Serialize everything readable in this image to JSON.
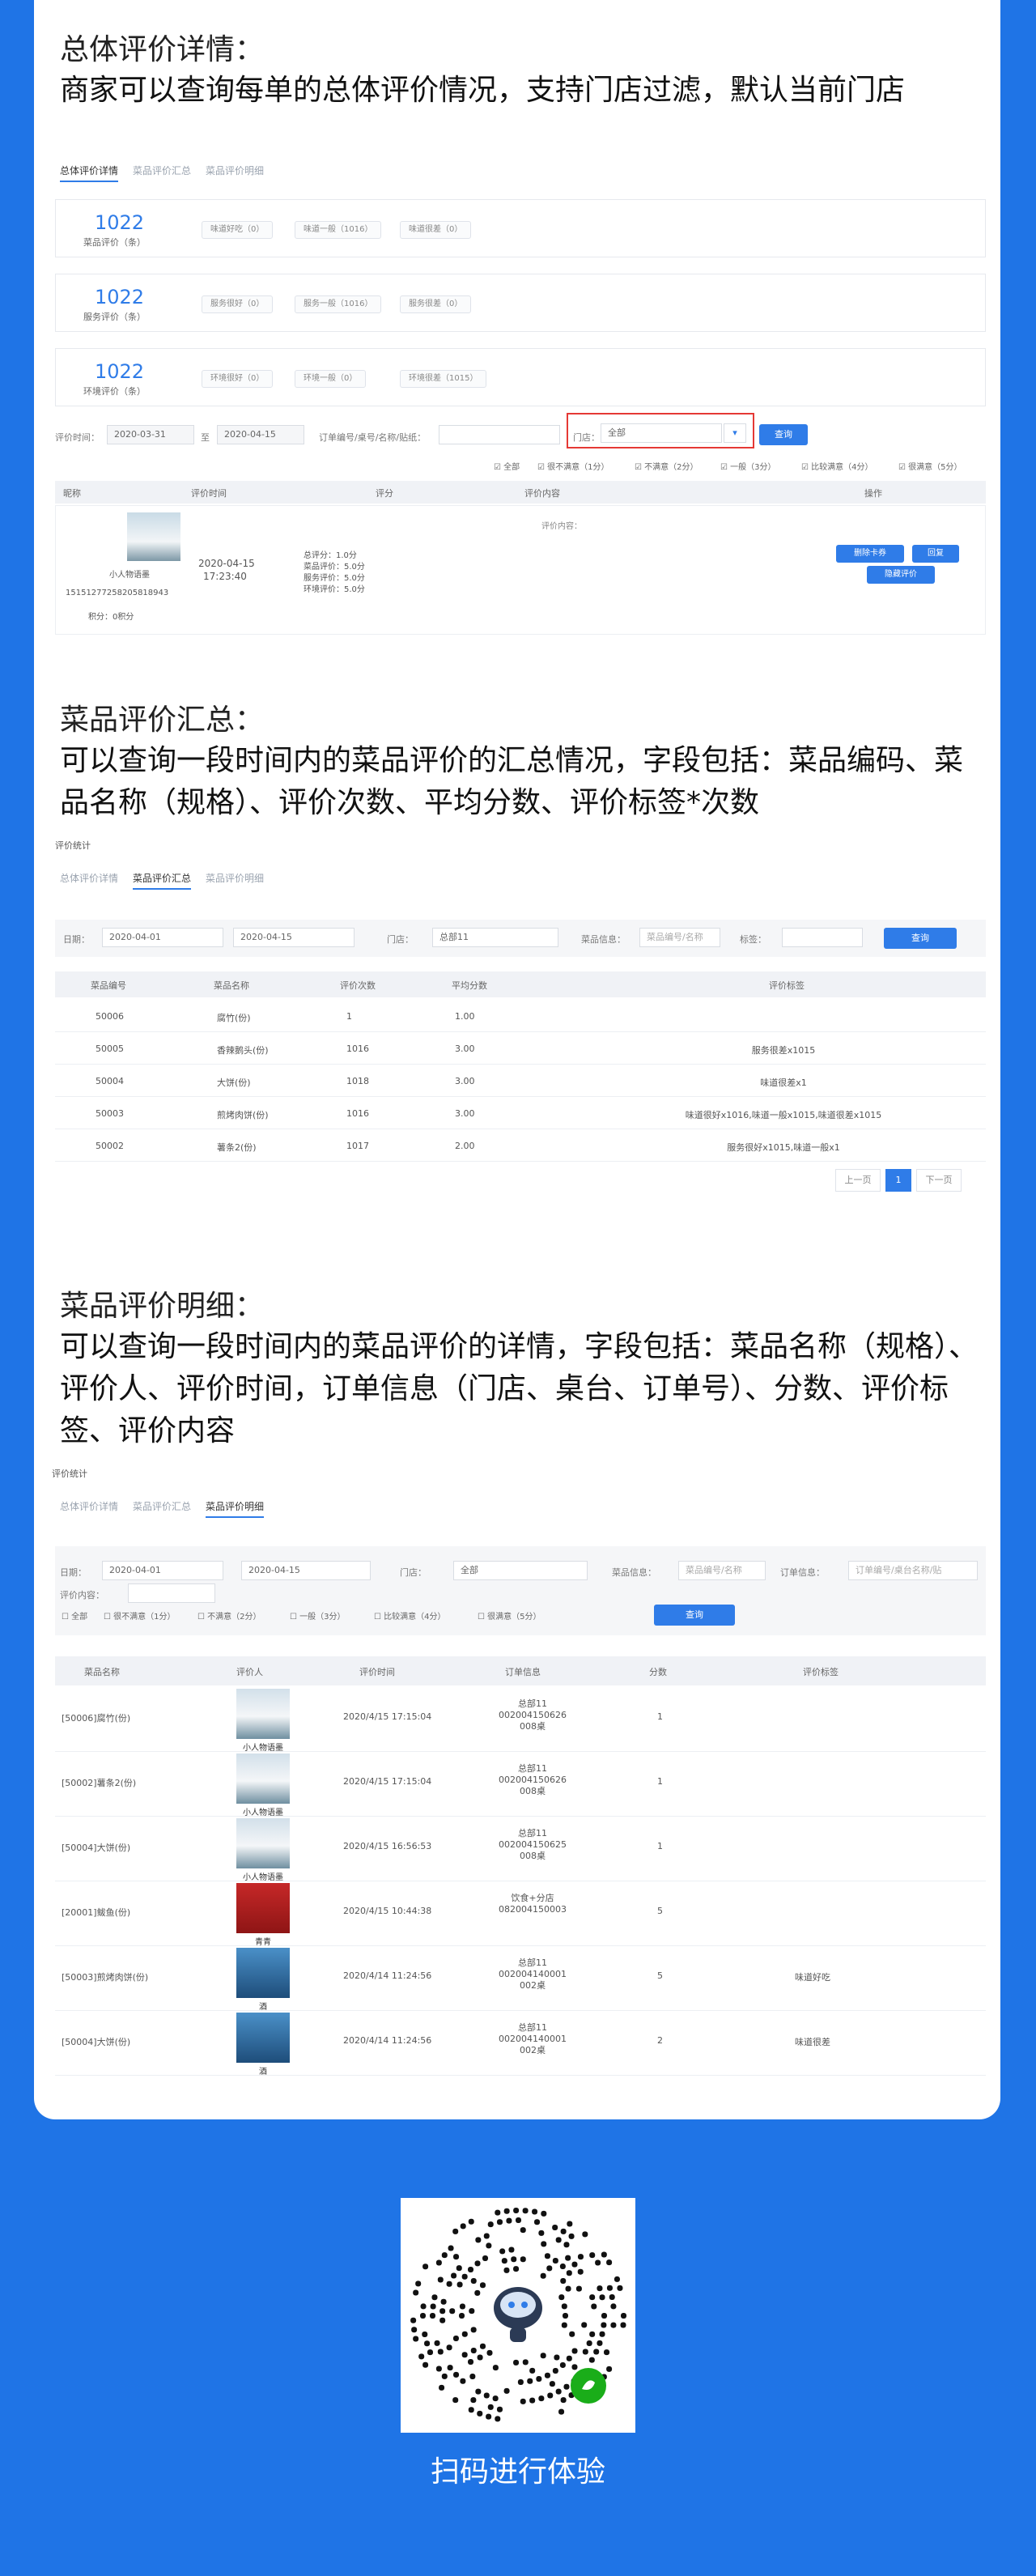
{
  "sec1": {
    "title": "总体评价详情：",
    "desc": "商家可以查询每单的总体评价情况，支持门店过滤，默认当前门店"
  },
  "tabs": [
    "总体评价详情",
    "菜品评价汇总",
    "菜品评价明细"
  ],
  "summary": [
    {
      "num": "1022",
      "label": "菜品评价（条）",
      "chips": [
        "味道好吃（0）",
        "味道一般（1016）",
        "味道很差（0）"
      ]
    },
    {
      "num": "1022",
      "label": "服务评价（条）",
      "chips": [
        "服务很好（0）",
        "服务一般（1016）",
        "服务很差（0）"
      ]
    },
    {
      "num": "1022",
      "label": "环境评价（条）",
      "chips": [
        "环境很好（0）",
        "环境一般（0）",
        "环境很差（1015）"
      ]
    }
  ],
  "filter1": {
    "time_label": "评价时间：",
    "from": "2020-03-31",
    "to_label": "至",
    "to": "2020-04-15",
    "order_label": "订单编号/桌号/名称/贴纸：",
    "store_label": "门店：",
    "store": "全部",
    "query": "查询"
  },
  "levels": [
    "全部",
    "很不满意（1分）",
    "不满意（2分）",
    "一般（3分）",
    "比较满意（4分）",
    "很满意（5分）"
  ],
  "table1": {
    "headers": [
      "昵称",
      "评价时间",
      "评分",
      "评价内容",
      "操作"
    ],
    "row": {
      "name": "小人物语墨",
      "id": "15151277258205818943",
      "points": "积分：0积分",
      "date": "2020-04-15",
      "time": "17:23:40",
      "scores": [
        "总评分：1.0分",
        "菜品评价：5.0分",
        "服务评价：5.0分",
        "环境评价：5.0分"
      ],
      "content": "评价内容：",
      "actions": [
        "删除卡券",
        "回复",
        "隐藏评价"
      ]
    }
  },
  "sec2": {
    "title": "菜品评价汇总：",
    "desc": "可以查询一段时间内的菜品评价的汇总情况，字段包括：菜品编码、菜品名称（规格）、评价次数、平均分数、评价标签*次数"
  },
  "crumb": "评价统计",
  "filter2": {
    "date_label": "日期：",
    "from": "2020-04-01",
    "to": "2020-04-15",
    "store_label": "门店：",
    "store": "总部11",
    "dish_label": "菜品信息：",
    "dish_ph": "菜品编号/名称",
    "tag_label": "标签：",
    "query": "查询"
  },
  "table2": {
    "headers": [
      "菜品编号",
      "菜品名称",
      "评价次数",
      "平均分数",
      "评价标签"
    ],
    "rows": [
      [
        "50006",
        "腐竹(份)",
        "1",
        "1.00",
        ""
      ],
      [
        "50005",
        "香辣鹅头(份)",
        "1016",
        "3.00",
        "服务很差x1015"
      ],
      [
        "50004",
        "大饼(份)",
        "1018",
        "3.00",
        "味道很差x1"
      ],
      [
        "50003",
        "煎烤肉饼(份)",
        "1016",
        "3.00",
        "味道很好x1016,味道一般x1015,味道很差x1015"
      ],
      [
        "50002",
        "薯条2(份)",
        "1017",
        "2.00",
        "服务很好x1015,味道一般x1"
      ]
    ]
  },
  "pager": {
    "prev": "上一页",
    "page": "1",
    "next": "下一页"
  },
  "sec3": {
    "title": "菜品评价明细：",
    "desc": "可以查询一段时间内的菜品评价的详情，字段包括：菜品名称（规格）、评价人、评价时间，订单信息（门店、桌台、订单号）、分数、评价标签、评价内容"
  },
  "filter3": {
    "date_label": "日期：",
    "from": "2020-04-01",
    "to": "2020-04-15",
    "store_label": "门店：",
    "store": "全部",
    "dish_label": "菜品信息：",
    "dish_ph": "菜品编号/名称",
    "order_label": "订单信息：",
    "order_ph": "订单编号/桌台名称/贴",
    "content_label": "评价内容：",
    "query": "查询"
  },
  "table3": {
    "headers": [
      "菜品名称",
      "评价人",
      "评价时间",
      "订单信息",
      "分数",
      "评价标签"
    ],
    "rows": [
      {
        "dish": "[50006]腐竹(份)",
        "user": "小人物语墨",
        "time": "2020/4/15 17:15:04",
        "order": [
          "总部11",
          "002004150626",
          "008桌"
        ],
        "score": "1",
        "tag": ""
      },
      {
        "dish": "[50002]薯条2(份)",
        "user": "小人物语墨",
        "time": "2020/4/15 17:15:04",
        "order": [
          "总部11",
          "002004150626",
          "008桌"
        ],
        "score": "1",
        "tag": ""
      },
      {
        "dish": "[50004]大饼(份)",
        "user": "小人物语墨",
        "time": "2020/4/15 16:56:53",
        "order": [
          "总部11",
          "002004150625",
          "008桌"
        ],
        "score": "1",
        "tag": ""
      },
      {
        "dish": "[20001]鲅鱼(份)",
        "user": "青青",
        "time": "2020/4/15 10:44:38",
        "order": [
          "饮食+分店",
          "082004150003"
        ],
        "score": "5",
        "tag": ""
      },
      {
        "dish": "[50003]煎烤肉饼(份)",
        "user": "酒",
        "time": "2020/4/14 11:24:56",
        "order": [
          "总部11",
          "002004140001",
          "002桌"
        ],
        "score": "5",
        "tag": "味道好吃"
      },
      {
        "dish": "[50004]大饼(份)",
        "user": "酒",
        "time": "2020/4/14 11:24:56",
        "order": [
          "总部11",
          "002004140001",
          "002桌"
        ],
        "score": "2",
        "tag": "味道很差"
      }
    ]
  },
  "footer": {
    "qr_text": "扫码进行体验"
  }
}
